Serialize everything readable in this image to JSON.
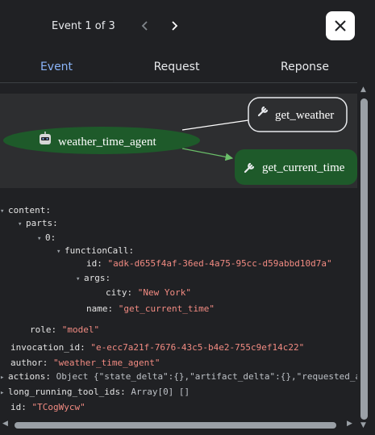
{
  "header": {
    "counter": "Event 1 of 3",
    "prev_icon": "chevron-left-icon",
    "next_icon": "chevron-right-icon",
    "close_icon": "close-icon"
  },
  "tabs": [
    {
      "label": "Event",
      "active": true
    },
    {
      "label": "Request",
      "active": false
    },
    {
      "label": "Reponse",
      "active": false
    }
  ],
  "graph": {
    "agent_label": "weather_time_agent",
    "agent_icon": "robot-icon",
    "tool_icon": "wrench-icon",
    "tools": [
      {
        "label": "get_weather",
        "active": false
      },
      {
        "label": "get_current_time",
        "active": true
      }
    ],
    "colors": {
      "node_active": "#1e5a2a",
      "edge": "#ffffff",
      "edge_active": "#6abf69"
    }
  },
  "tree": {
    "content_key": "content:",
    "parts_key": "parts:",
    "index_key": "0:",
    "function_call_key": "functionCall:",
    "id_key": "id:",
    "id_value": "\"adk-d655f4af-36ed-4a75-95cc-d59abbd10d7a\"",
    "args_key": "args:",
    "city_key": "city:",
    "city_value": "\"New York\"",
    "name_key": "name:",
    "name_value": "\"get_current_time\"",
    "role_key": "role:",
    "role_value": "\"model\"",
    "invocation_key": "invocation_id:",
    "invocation_value": "\"e-ecc7a21f-7676-43c5-b4e2-755c9ef14c22\"",
    "author_key": "author:",
    "author_value": "\"weather_time_agent\"",
    "actions_key": "actions:",
    "actions_value": "Object {\"state_delta\":{},\"artifact_delta\":{},\"requested_auth_co",
    "long_running_key": "long_running_tool_ids:",
    "long_running_value": "Array[0] []",
    "event_id_key": "id:",
    "event_id_value": "\"TCogWycw\""
  }
}
